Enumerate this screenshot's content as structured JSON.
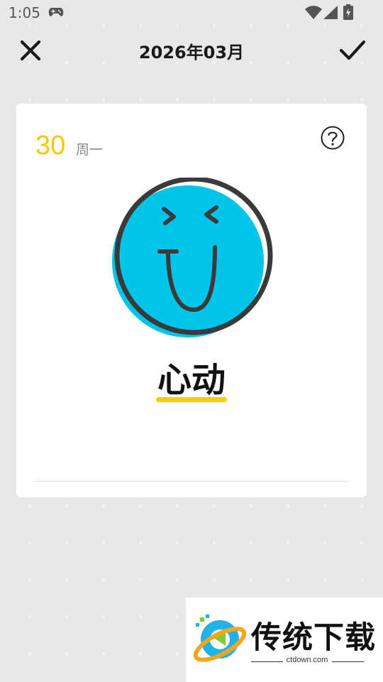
{
  "status_bar": {
    "time": "1:05",
    "icons": [
      "game-controller-icon",
      "wifi-icon",
      "signal-icon",
      "battery-charging-icon"
    ]
  },
  "toolbar": {
    "title": "2026年03月",
    "close_icon": "close-icon",
    "confirm_icon": "check-icon"
  },
  "card": {
    "day": "30",
    "weekday": "周一",
    "help_icon": "question-circle-icon",
    "mood": {
      "icon": "laughing-face-icon",
      "label": "心动",
      "face_color": "#00c4e8",
      "underline_color": "#f5d000"
    }
  },
  "colors": {
    "accent_day": "#f5c800",
    "background": "#e8e8e8"
  },
  "watermark": {
    "title": "传统下载",
    "subtitle": "ctdown.com"
  }
}
